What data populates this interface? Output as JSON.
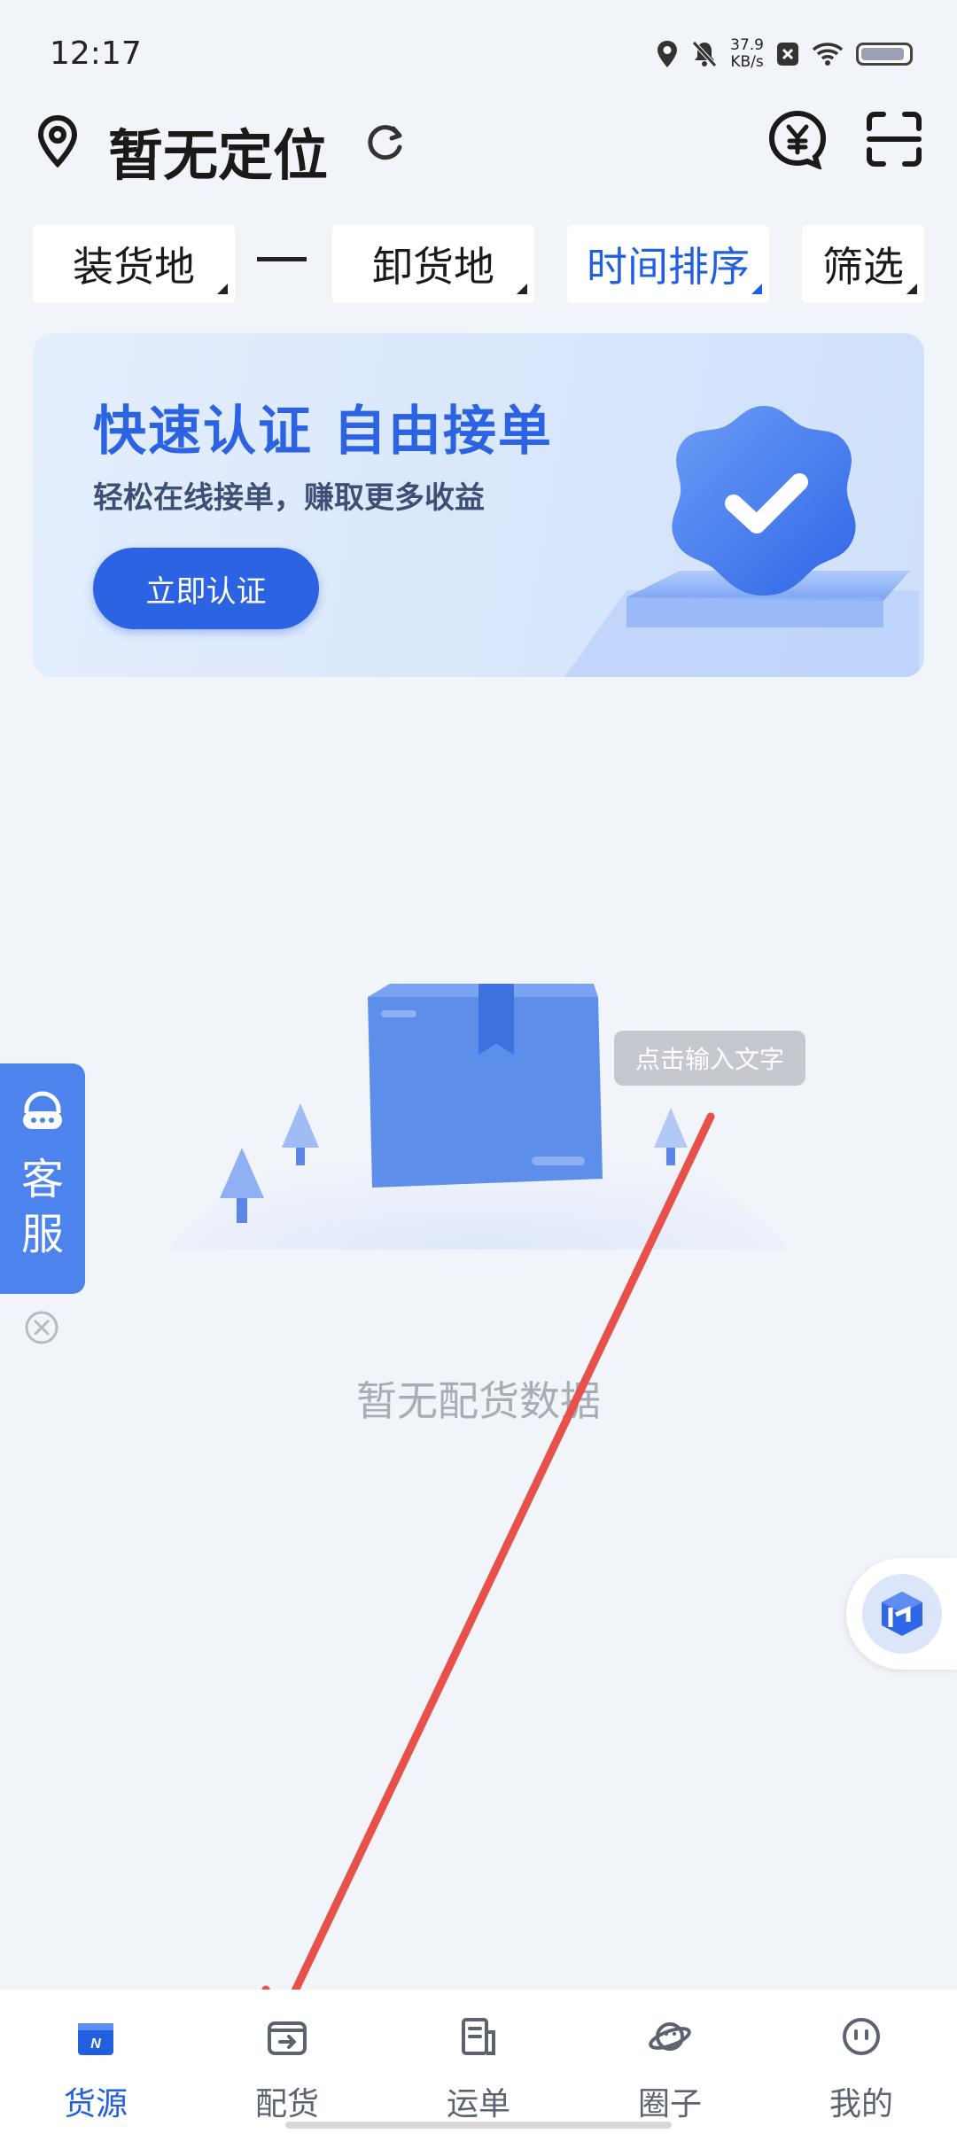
{
  "status_bar": {
    "time": "12:17",
    "net_speed_value": "37.9",
    "net_speed_unit": "KB/s"
  },
  "header": {
    "location_text": "暂无定位"
  },
  "filters": {
    "loading_place": "装货地",
    "separator": "一",
    "unloading_place": "卸货地",
    "sort": "时间排序",
    "filter": "筛选"
  },
  "banner": {
    "title": "快速认证 自由接单",
    "subtitle": "轻松在线接单，赚取更多收益",
    "button": "立即认证"
  },
  "empty_state": {
    "tooltip": "点击输入文字",
    "message": "暂无配货数据"
  },
  "customer_service": {
    "label_line1": "客",
    "label_line2": "服"
  },
  "bottom_nav": {
    "items": [
      {
        "label": "货源",
        "icon": "cargo-source-icon"
      },
      {
        "label": "配货",
        "icon": "dispatch-icon"
      },
      {
        "label": "运单",
        "icon": "waybill-icon"
      },
      {
        "label": "圈子",
        "icon": "planet-icon"
      },
      {
        "label": "我的",
        "icon": "profile-icon"
      }
    ],
    "active_index": 0
  },
  "colors": {
    "accent": "#1f5fe0",
    "banner_button": "#2b63e3",
    "background": "#f1f4f9",
    "annotation_arrow": "#e8504a"
  }
}
